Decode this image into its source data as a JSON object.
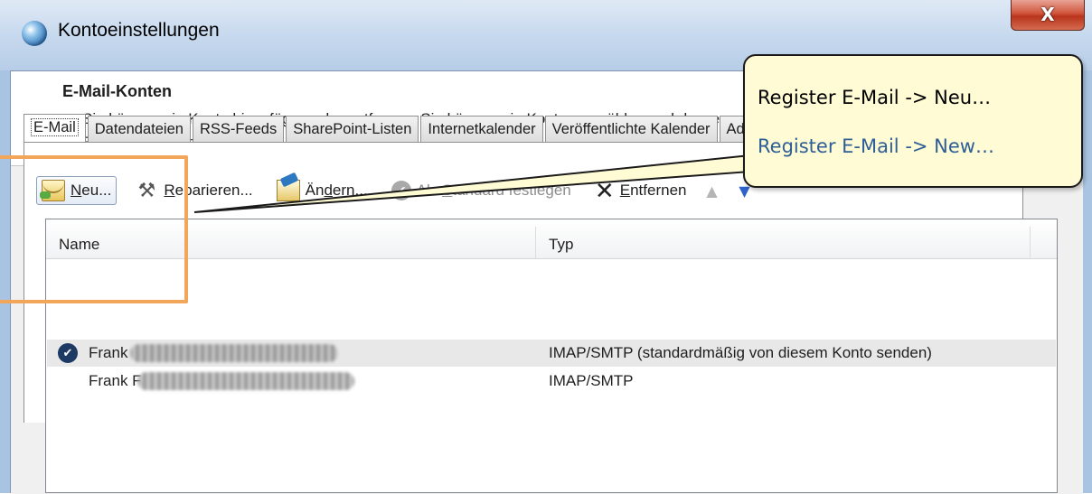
{
  "window": {
    "title": "Kontoeinstellungen",
    "close_label": "X"
  },
  "header": {
    "title": "E-Mail-Konten",
    "description": "Sie können ein Konto hinzufügen oder entfernen. Sie können ein Konto auswählen und dessen Einstellungen ändern."
  },
  "tabs": [
    {
      "label": "E-Mail",
      "active": true
    },
    {
      "label": "Datendateien"
    },
    {
      "label": "RSS-Feeds"
    },
    {
      "label": "SharePoint-Listen"
    },
    {
      "label": "Internetkalender"
    },
    {
      "label": "Veröffentlichte Kalender"
    },
    {
      "label": "Adressbücher"
    }
  ],
  "toolbar": {
    "new": {
      "pre": "",
      "ul": "N",
      "post": "eu..."
    },
    "repair": {
      "pre": "",
      "ul": "R",
      "post": "eparieren..."
    },
    "change": {
      "pre": "Än",
      "ul": "d",
      "post": "ern..."
    },
    "set_default": {
      "pre": "Als ",
      "ul": "S",
      "post": "tandard festlegen"
    },
    "remove": {
      "pre": "",
      "ul": "E",
      "post": "ntfernen"
    },
    "move_up_icon": "arrow-up-icon",
    "move_down_icon": "arrow-down-icon"
  },
  "list": {
    "columns": {
      "name": "Name",
      "type": "Typ"
    },
    "rows": [
      {
        "name": "Frank",
        "type": "IMAP/SMTP (standardmäßig von diesem Konto senden)",
        "default": true
      },
      {
        "name": "Frank F",
        "type": "IMAP/SMTP",
        "default": false
      }
    ]
  },
  "callout": {
    "line1": "Register E-Mail -> Neu…",
    "line2": "Register E-Mail -> New…"
  },
  "colors": {
    "callout_bg": "#fffbd4",
    "callout_line2": "#2e5e97",
    "highlight": "#f2a65a",
    "title_bar": "#c7d9ee"
  }
}
